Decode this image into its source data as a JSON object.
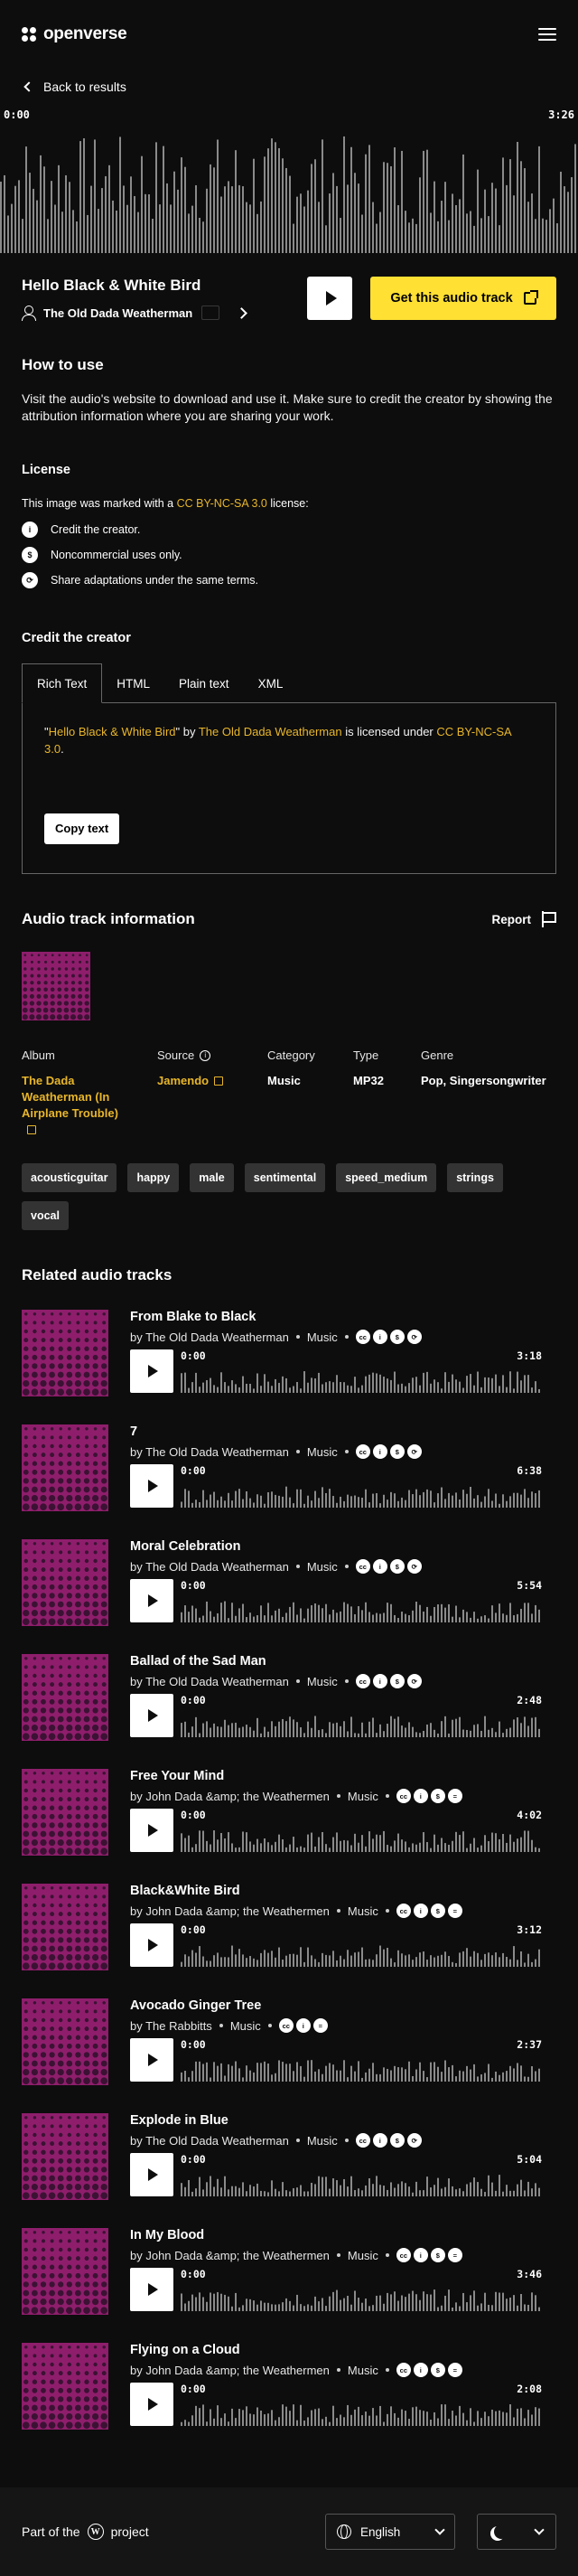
{
  "header": {
    "logo_text": "openverse"
  },
  "nav": {
    "back_label": "Back to results"
  },
  "player": {
    "current_time": "0:00",
    "duration": "3:26"
  },
  "track": {
    "title": "Hello Black & White Bird",
    "creator": "The Old Dada Weatherman",
    "get_button": "Get this audio track"
  },
  "how_to_use": {
    "heading": "How to use",
    "text": "Visit the audio's website to download and use it. Make sure to credit the creator by showing the attribution information where you are sharing your work."
  },
  "license": {
    "heading": "License",
    "lead_prefix": "This image was marked with a ",
    "license_name": "CC BY-NC-SA 3.0",
    "lead_suffix": " license:",
    "items": [
      {
        "icon": "by-icon",
        "icon_text": "i",
        "text": "Credit the creator."
      },
      {
        "icon": "nc-icon",
        "icon_text": "$",
        "text": "Noncommercial uses only."
      },
      {
        "icon": "sa-icon",
        "icon_text": "⟳",
        "text": "Share adaptations under the same terms."
      }
    ]
  },
  "credit": {
    "heading": "Credit the creator",
    "tabs": [
      "Rich Text",
      "HTML",
      "Plain text",
      "XML"
    ],
    "attribution": {
      "q1": "\"",
      "title": "Hello Black & White Bird",
      "q2": "\" by ",
      "creator": "The Old Dada Weatherman",
      "mid": " is licensed under ",
      "license": "CC BY-NC-SA 3.0",
      "end": "."
    },
    "copy_button": "Copy text"
  },
  "info": {
    "heading": "Audio track information",
    "report_label": "Report",
    "album_label": "Album",
    "album_value": "The Dada Weatherman (In Airplane Trouble)",
    "source_label": "Source",
    "source_value": "Jamendo",
    "category_label": "Category",
    "category_value": "Music",
    "type_label": "Type",
    "type_value": "MP32",
    "genre_label": "Genre",
    "genre_value": "Pop, Singersongwriter",
    "tags": [
      "acousticguitar",
      "happy",
      "male",
      "sentimental",
      "speed_medium",
      "strings",
      "vocal"
    ]
  },
  "related": {
    "heading": "Related audio tracks",
    "tracks": [
      {
        "title": "From Blake to Black",
        "by": "by The Old Dada Weatherman",
        "category": "Music",
        "licenses": [
          "cc",
          "by",
          "nc",
          "sa"
        ],
        "start": "0:00",
        "duration": "3:18"
      },
      {
        "title": "7",
        "by": "by The Old Dada Weatherman",
        "category": "Music",
        "licenses": [
          "cc",
          "by",
          "nc",
          "sa"
        ],
        "start": "0:00",
        "duration": "6:38"
      },
      {
        "title": "Moral Celebration",
        "by": "by The Old Dada Weatherman",
        "category": "Music",
        "licenses": [
          "cc",
          "by",
          "nc",
          "sa"
        ],
        "start": "0:00",
        "duration": "5:54"
      },
      {
        "title": "Ballad of the Sad Man",
        "by": "by The Old Dada Weatherman",
        "category": "Music",
        "licenses": [
          "cc",
          "by",
          "nc",
          "sa"
        ],
        "start": "0:00",
        "duration": "2:48"
      },
      {
        "title": "Free Your Mind",
        "by": "by John Dada &amp; the Weathermen",
        "category": "Music",
        "licenses": [
          "cc",
          "by",
          "nc",
          "nd"
        ],
        "start": "0:00",
        "duration": "4:02"
      },
      {
        "title": "Black&White Bird",
        "by": "by John Dada &amp; the Weathermen",
        "category": "Music",
        "licenses": [
          "cc",
          "by",
          "nc",
          "nd"
        ],
        "start": "0:00",
        "duration": "3:12"
      },
      {
        "title": "Avocado Ginger Tree",
        "by": "by The Rabbitts",
        "category": "Music",
        "licenses": [
          "cc",
          "by",
          "nd"
        ],
        "start": "0:00",
        "duration": "2:37"
      },
      {
        "title": "Explode in Blue",
        "by": "by The Old Dada Weatherman",
        "category": "Music",
        "licenses": [
          "cc",
          "by",
          "nc",
          "sa"
        ],
        "start": "0:00",
        "duration": "5:04"
      },
      {
        "title": "In My Blood",
        "by": "by John Dada &amp; the Weathermen",
        "category": "Music",
        "licenses": [
          "cc",
          "by",
          "nc",
          "nd"
        ],
        "start": "0:00",
        "duration": "3:46"
      },
      {
        "title": "Flying on a Cloud",
        "by": "by John Dada &amp; the Weathermen",
        "category": "Music",
        "licenses": [
          "cc",
          "by",
          "nc",
          "nd"
        ],
        "start": "0:00",
        "duration": "2:08"
      }
    ]
  },
  "footer": {
    "part_of_prefix": "Part of the",
    "part_of_suffix": "project",
    "language": "English"
  },
  "colors": {
    "background": "#0d0d0d",
    "accent_yellow": "#ffe033",
    "link_gold": "#e8b62b",
    "thumbnail_magenta": "#8e1e6c"
  }
}
